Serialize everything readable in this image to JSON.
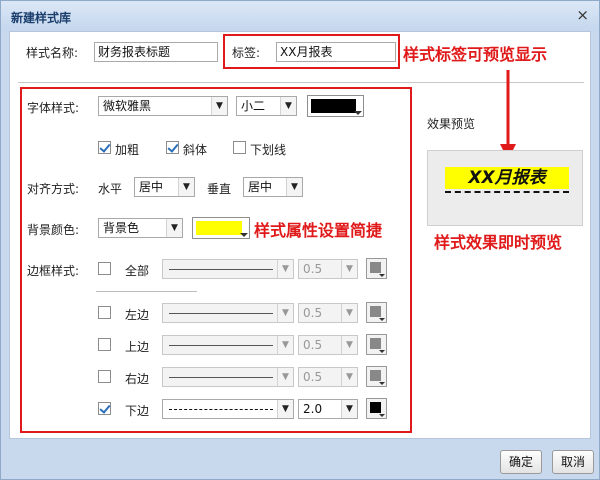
{
  "dialog": {
    "title": "新建样式库",
    "close_glyph": "×"
  },
  "header": {
    "style_name_label": "样式名称:",
    "style_name_value": "财务报表标题",
    "tag_label": "标签:",
    "tag_value": "XX月报表"
  },
  "font": {
    "label": "字体样式:",
    "family": "微软雅黑",
    "size": "小二",
    "color": "#000000",
    "bold_label": "加粗",
    "bold_checked": true,
    "italic_label": "斜体",
    "italic_checked": true,
    "underline_label": "下划线",
    "underline_checked": false
  },
  "align": {
    "label": "对齐方式:",
    "horizontal_label": "水平",
    "horizontal_value": "居中",
    "vertical_label": "垂直",
    "vertical_value": "居中"
  },
  "background": {
    "label": "背景颜色:",
    "type": "背景色",
    "color": "#ffff00"
  },
  "border": {
    "label": "边框样式:",
    "all": {
      "label": "全部",
      "checked": false,
      "style": "solid",
      "width": "0.5",
      "enabled": false,
      "color": "#888888"
    },
    "left": {
      "label": "左边",
      "checked": false,
      "style": "solid",
      "width": "0.5",
      "enabled": false,
      "color": "#888888"
    },
    "top": {
      "label": "上边",
      "checked": false,
      "style": "solid",
      "width": "0.5",
      "enabled": false,
      "color": "#888888"
    },
    "right": {
      "label": "右边",
      "checked": false,
      "style": "solid",
      "width": "0.5",
      "enabled": false,
      "color": "#888888"
    },
    "bottom": {
      "label": "下边",
      "checked": true,
      "style": "dashed",
      "width": "2.0",
      "enabled": true,
      "color": "#000000"
    }
  },
  "preview": {
    "title": "效果预览",
    "text": "XX月报表"
  },
  "annotations": {
    "tag_preview": "样式标签可预览显示",
    "attr_setting": "样式属性设置简捷",
    "instant_preview": "样式效果即时预览"
  },
  "buttons": {
    "ok": "确定",
    "cancel": "取消"
  },
  "colors": {
    "annotation_red": "#e01a1a",
    "title_blue": "#1a3d6b",
    "frame_blue": "#c8d9ee"
  }
}
